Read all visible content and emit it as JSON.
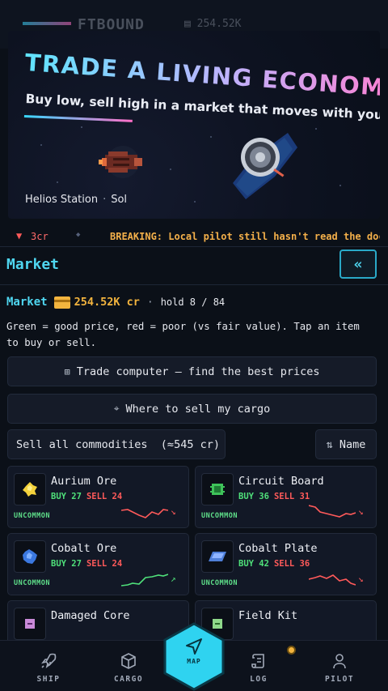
{
  "header": {
    "brand": "FTBOUND",
    "credits": "254.52K"
  },
  "hero": {
    "title": "TRADE A LIVING ECONOMY",
    "subtitle": "Buy low, sell high in a market that moves with you",
    "station": "Helios Station",
    "system": "Sol"
  },
  "ticker": {
    "price_change": "3cr",
    "headline": "BREAKING: Local pilot still hasn't read the docs"
  },
  "market": {
    "title": "Market",
    "collapse_label": "«",
    "label": "Market",
    "credits": "254.52K cr",
    "hold": "hold 8 / 84",
    "help": "Green = good price, red = poor (vs fair value). Tap an item to buy or sell.",
    "trade_computer": "Trade computer — find the best prices",
    "where_to_sell": "Where to sell my cargo",
    "sell_all": "Sell all commodities  (≈545 cr)",
    "sort_label": "Name"
  },
  "commodities": [
    {
      "name": "Aurium Ore",
      "buy": "BUY 27",
      "sell": "SELL 24",
      "rarity": "UNCOMMON",
      "trend": "down",
      "icon": "aurium-ore-icon",
      "color": "#f4d23c"
    },
    {
      "name": "Circuit Board",
      "buy": "BUY 36",
      "sell": "SELL 31",
      "rarity": "UNCOMMON",
      "trend": "down",
      "icon": "circuit-board-icon",
      "color": "#3fc35a"
    },
    {
      "name": "Cobalt Ore",
      "buy": "BUY 27",
      "sell": "SELL 24",
      "rarity": "UNCOMMON",
      "trend": "up",
      "icon": "cobalt-ore-icon",
      "color": "#3b78e0"
    },
    {
      "name": "Cobalt Plate",
      "buy": "BUY 42",
      "sell": "SELL 36",
      "rarity": "UNCOMMON",
      "trend": "down",
      "icon": "cobalt-plate-icon",
      "color": "#4f7fd8"
    },
    {
      "name": "Damaged Core",
      "icon": "damaged-core-icon",
      "color": "#c98ad8"
    },
    {
      "name": "Field Kit",
      "icon": "field-kit-icon",
      "color": "#8fd88a"
    }
  ],
  "nav": {
    "ship": "SHIP",
    "cargo": "CARGO",
    "map": "MAP",
    "log": "LOG",
    "pilot": "PILOT"
  },
  "colors": {
    "accent": "#4fd6f0",
    "good": "#4fe07a",
    "bad": "#ff5a5a",
    "gold": "#f3b43e"
  }
}
